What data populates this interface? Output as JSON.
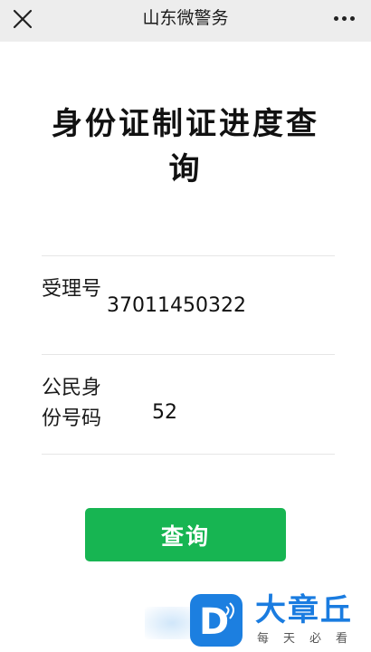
{
  "navbar": {
    "title": "山东微警务",
    "close_icon": "close-icon",
    "more_icon": "more-icon"
  },
  "page": {
    "title": "身份证制证进度查询"
  },
  "form": {
    "acceptance_label": "受理号",
    "acceptance_value": "37011450322",
    "id_label": "公民身份号码",
    "id_value": "52"
  },
  "actions": {
    "query_label": "查询"
  },
  "watermark": {
    "name": "大章丘",
    "tagline": "每天必看",
    "badge_letter": "D"
  },
  "colors": {
    "navbar_bg": "#ededed",
    "button_green": "#17b552",
    "watermark_blue": "#1c7fe0"
  }
}
